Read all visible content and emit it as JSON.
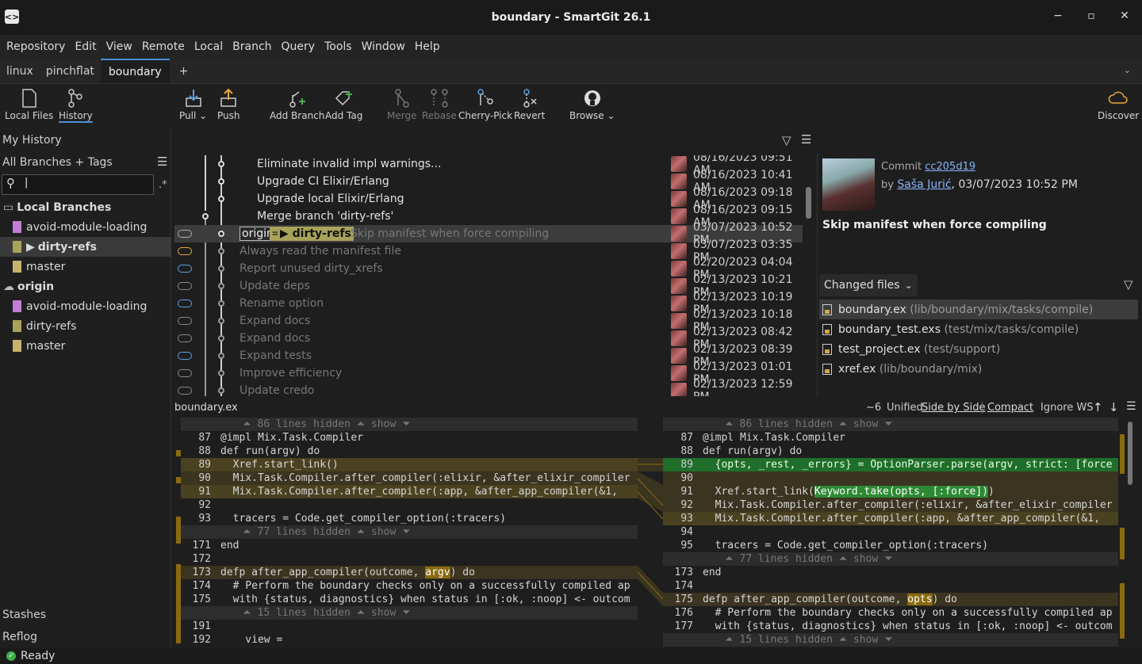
{
  "window": {
    "title": "boundary - SmartGit 26.1",
    "min": "−",
    "max": "▫",
    "close": "✕"
  },
  "menu": [
    "Repository",
    "Edit",
    "View",
    "Remote",
    "Local",
    "Branch",
    "Query",
    "Tools",
    "Window",
    "Help"
  ],
  "tabs": [
    {
      "label": "linux",
      "active": false
    },
    {
      "label": "pinchflat",
      "active": false
    },
    {
      "label": "boundary",
      "active": true
    }
  ],
  "tab_add": "+",
  "toolbar": {
    "local_files": "Local Files",
    "history": "History",
    "pull": "Pull",
    "push": "Push",
    "add_branch": "Add Branch",
    "add_tag": "Add Tag",
    "merge": "Merge",
    "rebase": "Rebase",
    "cherry_pick": "Cherry-Pick",
    "revert": "Revert",
    "browse": "Browse",
    "discover": "Discover",
    "dropdown": "⌄"
  },
  "sidebar": {
    "my_history": "My History",
    "all_branches": "All Branches + Tags",
    "search_cursor": "|",
    "regex_toggle": ".*",
    "local_branches": "Local Branches",
    "local": [
      {
        "label": "avoid-module-loading",
        "color": "#c37fd6"
      },
      {
        "label": "dirty-refs",
        "color": "#a8a35a",
        "prefix": "▶"
      },
      {
        "label": "master",
        "color": "#c8b26a"
      }
    ],
    "origin": "origin",
    "remote": [
      {
        "label": "avoid-module-loading",
        "color": "#c37fd6"
      },
      {
        "label": "dirty-refs",
        "color": "#a8a35a"
      },
      {
        "label": "master",
        "color": "#c8b26a"
      }
    ],
    "stashes": "Stashes",
    "reflog": "Reflog"
  },
  "log": {
    "rows": [
      {
        "msg": "Eliminate invalid impl warnings...",
        "date": "08/16/2023 09:51 AM",
        "dim": false
      },
      {
        "msg": "Upgrade CI Elixir/Erlang",
        "date": "08/16/2023 10:41 AM",
        "dim": false
      },
      {
        "msg": "Upgrade local Elixir/Erlang",
        "date": "08/16/2023 09:18 AM",
        "dim": false
      },
      {
        "msg": "Merge branch 'dirty-refs'",
        "date": "08/16/2023 09:15 AM",
        "dim": false
      },
      {
        "msg": "Skip manifest when force compiling",
        "date": "03/07/2023 10:52 PM",
        "dim": true,
        "selected": true
      },
      {
        "msg": "Always read the manifest file",
        "date": "03/07/2023 03:35 PM",
        "dim": true
      },
      {
        "msg": "Report unused dirty_xrefs",
        "date": "02/20/2023 04:04 PM",
        "dim": true
      },
      {
        "msg": "Update deps",
        "date": "02/13/2023 10:21 PM",
        "dim": true
      },
      {
        "msg": "Rename option",
        "date": "02/13/2023 10:19 PM",
        "dim": true
      },
      {
        "msg": "Expand docs",
        "date": "02/13/2023 10:18 PM",
        "dim": true
      },
      {
        "msg": "Expand docs",
        "date": "02/13/2023 08:42 PM",
        "dim": true
      },
      {
        "msg": "Expand tests",
        "date": "02/13/2023 08:39 PM",
        "dim": true
      },
      {
        "msg": "Improve efficiency",
        "date": "02/13/2023 01:01 PM",
        "dim": true
      },
      {
        "msg": "Update credo",
        "date": "02/13/2023 12:59 PM",
        "dim": true
      }
    ],
    "origin_tag": "origin",
    "eq": "=",
    "branch_tag": "▶ dirty-refs"
  },
  "commit": {
    "label": "Commit",
    "hash": "cc205d19",
    "by": "by",
    "author": "Saša Jurić",
    "date": ", 03/07/2023 10:52 PM",
    "message": "Skip manifest when force compiling"
  },
  "changed_files": {
    "label": "Changed files",
    "files": [
      {
        "name": "boundary.ex",
        "path": "(lib/boundary/mix/tasks/compile)",
        "selected": true
      },
      {
        "name": "boundary_test.exs",
        "path": "(test/mix/tasks/compile)",
        "selected": false
      },
      {
        "name": "test_project.ex",
        "path": "(test/support)",
        "selected": false
      },
      {
        "name": "xref.ex",
        "path": "(lib/boundary/mix)",
        "selected": false
      }
    ]
  },
  "diff": {
    "file": "boundary.ex",
    "context": "~6",
    "unified": "Unified",
    "side_by_side": "Side by Side",
    "compact": "Compact",
    "ignore_ws": "Ignore WS",
    "up": "↑",
    "down": "↓",
    "show": "show",
    "left_hidden": [
      "86 lines hidden",
      "77 lines hidden",
      "15 lines hidden"
    ],
    "right_hidden": [
      "86 lines hidden",
      "77 lines hidden",
      "15 lines hidden"
    ],
    "left": [
      {
        "n": "87",
        "code": "@impl Mix.Task.Compiler"
      },
      {
        "n": "88",
        "code": "def run(argv) do"
      },
      {
        "n": "89",
        "code": "  Xref.start_link()"
      },
      {
        "n": "90",
        "code": "  Mix.Task.Compiler.after_compiler(:elixir, &after_elixir_compiler"
      },
      {
        "n": "91",
        "code": "  Mix.Task.Compiler.after_compiler(:app, &after_app_compiler(&1,"
      },
      {
        "n": "92",
        "code": ""
      },
      {
        "n": "93",
        "code": "  tracers = Code.get_compiler_option(:tracers)"
      },
      {
        "n": "171",
        "code": "end"
      },
      {
        "n": "172",
        "code": ""
      },
      {
        "n": "173",
        "code": "defp after_app_compiler(outcome, "
      },
      {
        "n": "174",
        "code": "  # Perform the boundary checks only on a successfully compiled ap"
      },
      {
        "n": "175",
        "code": "  with {status, diagnostics} when status in [:ok, :noop] <- outcom"
      },
      {
        "n": "191",
        "code": ""
      },
      {
        "n": "192",
        "code": "    view ="
      }
    ],
    "left_hl": "argv",
    "left_tail": ") do",
    "right": [
      {
        "n": "87",
        "code": "@impl Mix.Task.Compiler"
      },
      {
        "n": "88",
        "code": "def run(argv) do"
      },
      {
        "n": "89",
        "code": "  {opts, _rest, _errors} = OptionParser.parse(argv, strict: [force"
      },
      {
        "n": "90",
        "code": ""
      },
      {
        "n": "91",
        "code": "  Xref.start_link("
      },
      {
        "n": "92",
        "code": "  Mix.Task.Compiler.after_compiler(:elixir, &after_elixir_compiler"
      },
      {
        "n": "93",
        "code": "  Mix.Task.Compiler.after_compiler(:app, &after_app_compiler(&1,"
      },
      {
        "n": "94",
        "code": ""
      },
      {
        "n": "95",
        "code": "  tracers = Code.get_compiler_option(:tracers)"
      },
      {
        "n": "173",
        "code": "end"
      },
      {
        "n": "174",
        "code": ""
      },
      {
        "n": "175",
        "code": "defp after_app_compiler(outcome, "
      },
      {
        "n": "176",
        "code": "  # Perform the boundary checks only on a successfully compiled ap"
      },
      {
        "n": "177",
        "code": "  with {status, diagnostics} when status in [:ok, :noop] <- outcom"
      }
    ],
    "right_hl_keyword": "Keyword.take(opts, [:force])",
    "right_tail91": ")",
    "right_hl": "opts",
    "right_tail": ") do"
  },
  "status": {
    "text": "Ready"
  }
}
